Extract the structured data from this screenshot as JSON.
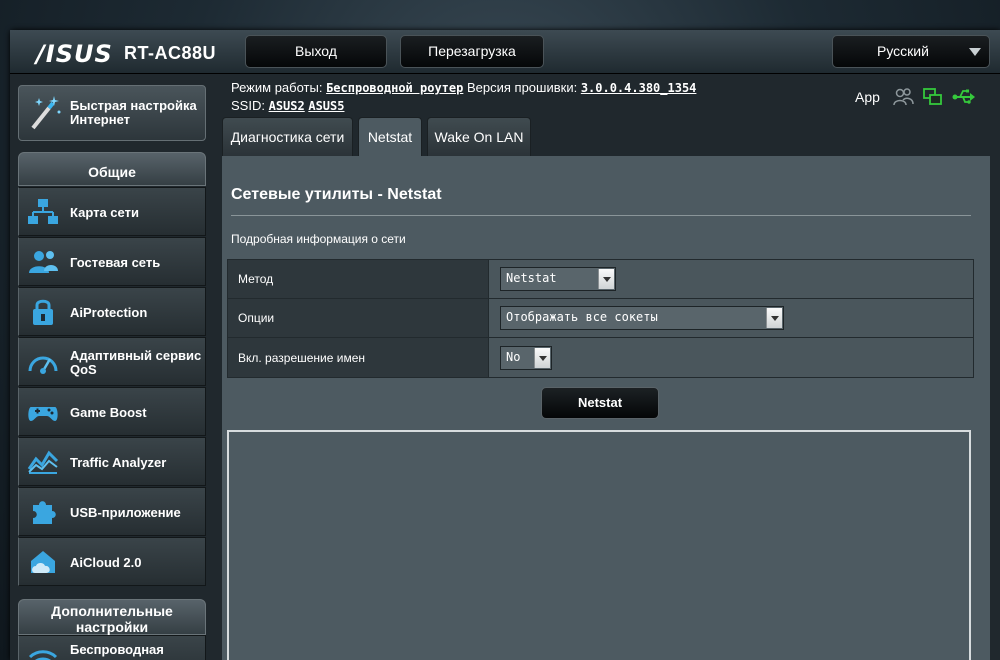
{
  "header": {
    "brand": "/ISUS",
    "model": "RT-AC88U",
    "logout_label": "Выход",
    "reboot_label": "Перезагрузка",
    "language": "Русский"
  },
  "info": {
    "mode_label": "Режим работы:",
    "mode_value": "Беспроводной роутер",
    "firmware_label": "Версия прошивки:",
    "firmware_value": "3.0.0.4.380_1354",
    "ssid_label": "SSID:",
    "ssid_1": "ASUS2",
    "ssid_2": "ASUS5",
    "app_label": "App"
  },
  "sidebar": {
    "quick_setup": "Быстрая настройка Интернет",
    "general_title": "Общие",
    "items": [
      {
        "label": "Карта сети"
      },
      {
        "label": "Гостевая сеть"
      },
      {
        "label": "AiProtection"
      },
      {
        "label": "Адаптивный сервис QoS"
      },
      {
        "label": "Game Boost"
      },
      {
        "label": "Traffic Analyzer"
      },
      {
        "label": "USB-приложение"
      },
      {
        "label": "AiCloud 2.0"
      }
    ],
    "advanced_title": "Дополнительные настройки",
    "advanced_items": [
      {
        "label": "Беспроводная"
      }
    ]
  },
  "tabs": [
    {
      "label": "Диагностика сети"
    },
    {
      "label": "Netstat"
    },
    {
      "label": "Wake On LAN"
    }
  ],
  "main": {
    "title": "Сетевые утилиты - Netstat",
    "subtitle": "Подробная информация о сети",
    "rows": [
      {
        "label": "Метод",
        "value": "Netstat"
      },
      {
        "label": "Опции",
        "value": "Отображать все сокеты"
      },
      {
        "label": "Вкл. разрешение имен",
        "value": "No"
      }
    ],
    "run_button": "Netstat"
  },
  "colors": {
    "content_bg": "#4d5a61",
    "label_bg": "#2e373c",
    "status_green": "#35c93c"
  }
}
